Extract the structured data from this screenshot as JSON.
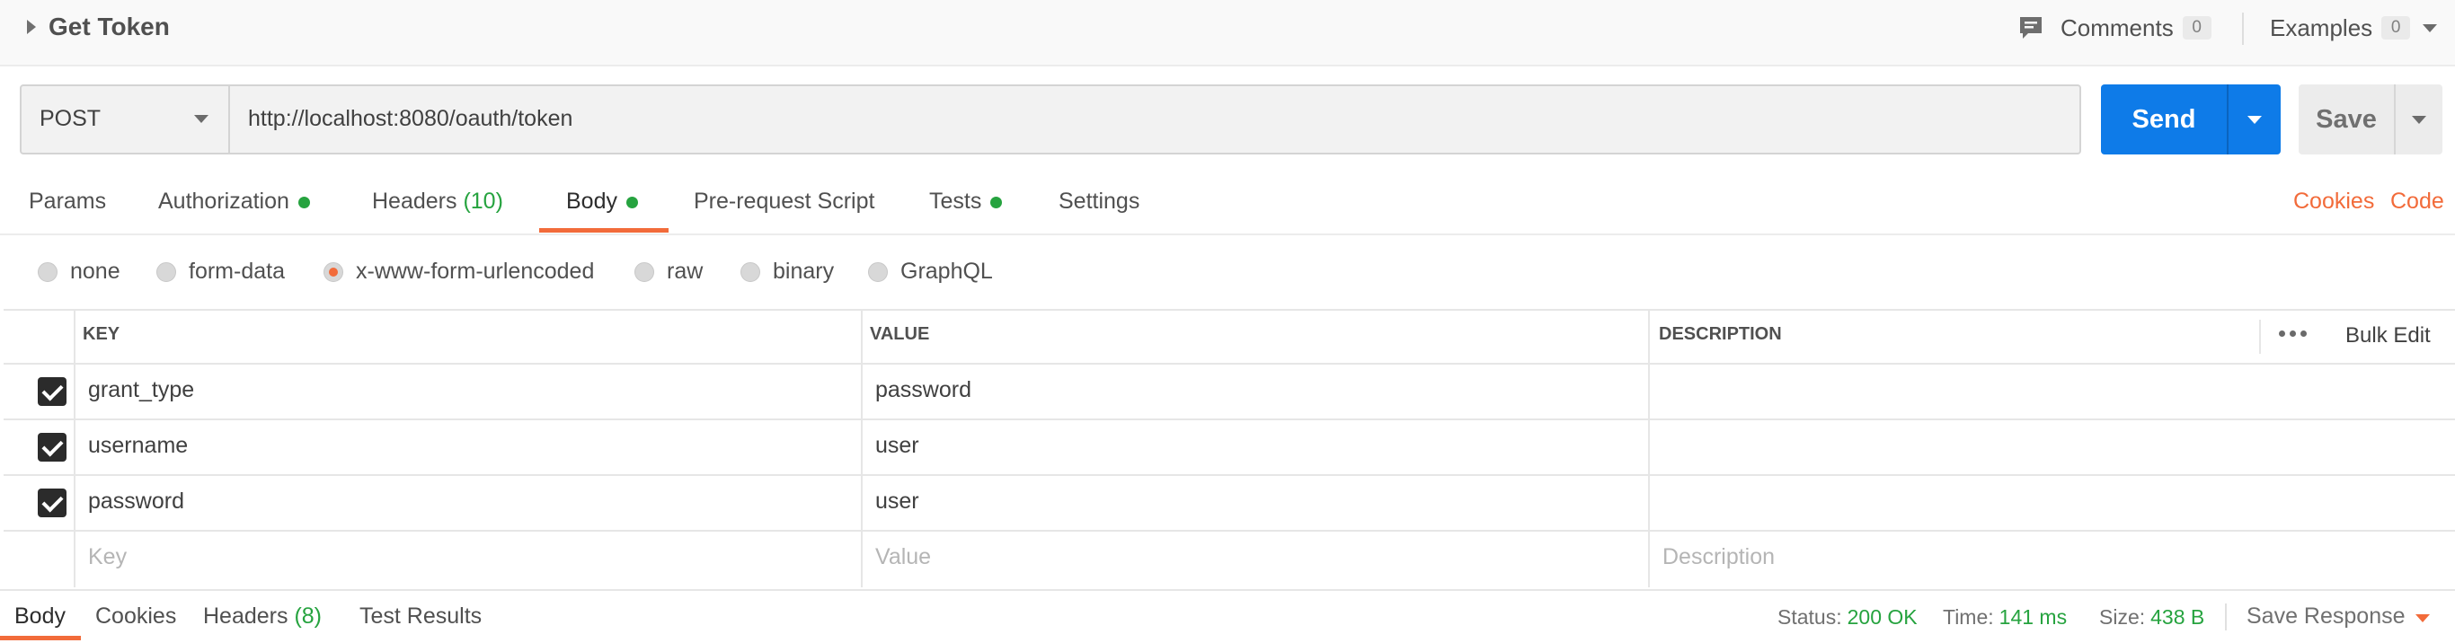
{
  "header": {
    "title": "Get Token",
    "comments_label": "Comments",
    "comments_count": "0",
    "examples_label": "Examples",
    "examples_count": "0"
  },
  "request": {
    "method": "POST",
    "url": "http://localhost:8080/oauth/token",
    "send_label": "Send",
    "save_label": "Save"
  },
  "tabs": [
    {
      "label": "Params"
    },
    {
      "label": "Authorization",
      "status": "dot"
    },
    {
      "label": "Headers",
      "count": "(10)"
    },
    {
      "label": "Body",
      "status": "dot",
      "active": true
    },
    {
      "label": "Pre-request Script"
    },
    {
      "label": "Tests",
      "status": "dot"
    },
    {
      "label": "Settings"
    }
  ],
  "tab_links": {
    "cookies": "Cookies",
    "code": "Code"
  },
  "body_types": [
    "none",
    "form-data",
    "x-www-form-urlencoded",
    "raw",
    "binary",
    "GraphQL"
  ],
  "body_type_selected": "x-www-form-urlencoded",
  "table": {
    "headers": {
      "key": "KEY",
      "value": "VALUE",
      "description": "DESCRIPTION"
    },
    "bulk_edit": "Bulk Edit",
    "rows": [
      {
        "key": "grant_type",
        "value": "password",
        "checked": true
      },
      {
        "key": "username",
        "value": "user",
        "checked": true
      },
      {
        "key": "password",
        "value": "user",
        "checked": true
      }
    ],
    "placeholders": {
      "key": "Key",
      "value": "Value",
      "description": "Description"
    }
  },
  "response": {
    "tabs": [
      {
        "label": "Body",
        "active": true
      },
      {
        "label": "Cookies"
      },
      {
        "label": "Headers",
        "count": "(8)"
      },
      {
        "label": "Test Results"
      }
    ],
    "status_label": "Status:",
    "status_value": "200 OK",
    "time_label": "Time:",
    "time_value": "141 ms",
    "size_label": "Size:",
    "size_value": "438 B",
    "save_response": "Save Response"
  },
  "colors": {
    "accent": "#f26b3a",
    "send": "#0e7be8",
    "ok_green": "#26a33f"
  },
  "icons": {
    "comments": "comment-icon",
    "expand": "caret-right-icon",
    "menu": "more-horizontal-icon"
  }
}
